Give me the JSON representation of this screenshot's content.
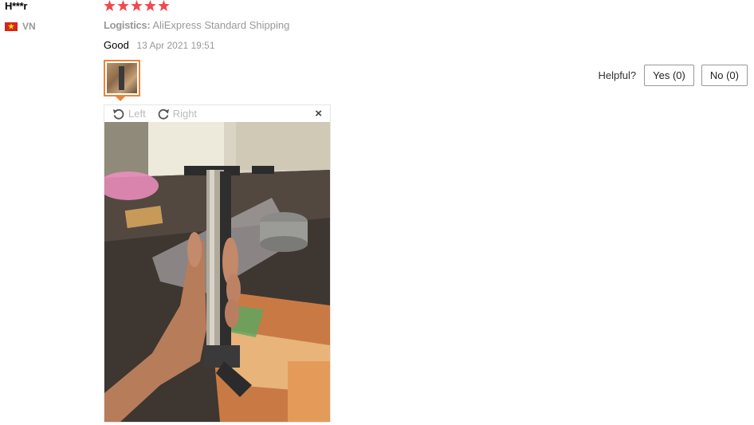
{
  "review": {
    "user_name": "H***r",
    "country_code": "VN",
    "rating": 5,
    "logistics_label": "Logistics:",
    "logistics_value": "AliExpress Standard Shipping",
    "feedback_text": "Good",
    "date": "13 Apr 2021 19:51"
  },
  "helpful": {
    "label": "Helpful?",
    "yes_label": "Yes (0)",
    "no_label": "No (0)"
  },
  "viewer": {
    "rotate_left_label": "Left",
    "rotate_right_label": "Right",
    "close_glyph": "×"
  },
  "colors": {
    "star": "#f0494f",
    "thumb_border": "#e9853a",
    "muted_text": "#999999"
  }
}
